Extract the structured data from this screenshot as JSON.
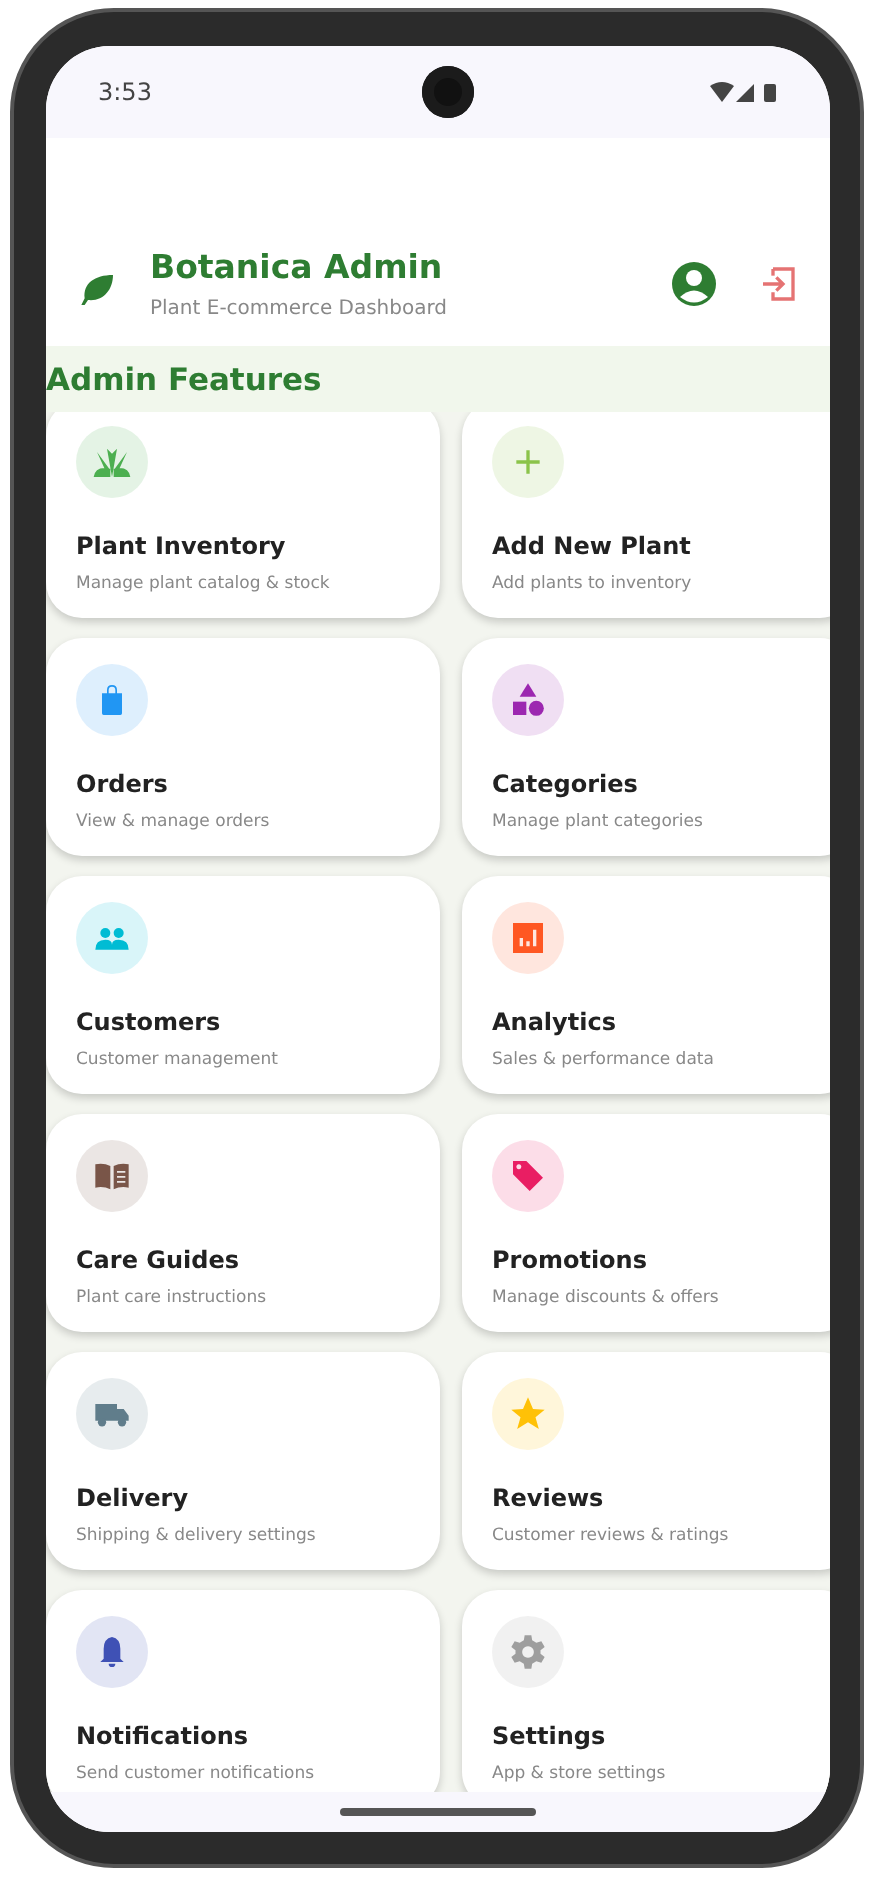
{
  "status_bar": {
    "time": "3:53"
  },
  "header": {
    "title": "Botanica Admin",
    "subtitle": "Plant E-commerce Dashboard"
  },
  "section": {
    "title": "Admin Features"
  },
  "features": [
    {
      "title": "Plant Inventory",
      "subtitle": "Manage plant catalog & stock",
      "color": "#4caf50"
    },
    {
      "title": "Add New Plant",
      "subtitle": "Add plants to inventory",
      "color": "#8bc34a"
    },
    {
      "title": "Orders",
      "subtitle": "View & manage orders",
      "color": "#2196f3"
    },
    {
      "title": "Categories",
      "subtitle": "Manage plant categories",
      "color": "#9c27b0"
    },
    {
      "title": "Customers",
      "subtitle": "Customer management",
      "color": "#00bcd4"
    },
    {
      "title": "Analytics",
      "subtitle": "Sales & performance data",
      "color": "#ff5722"
    },
    {
      "title": "Care Guides",
      "subtitle": "Plant care instructions",
      "color": "#795548"
    },
    {
      "title": "Promotions",
      "subtitle": "Manage discounts & offers",
      "color": "#e91e63"
    },
    {
      "title": "Delivery",
      "subtitle": "Shipping & delivery settings",
      "color": "#607d8b"
    },
    {
      "title": "Reviews",
      "subtitle": "Customer reviews & ratings",
      "color": "#ffc107"
    },
    {
      "title": "Notifications",
      "subtitle": "Send customer notifications",
      "color": "#3f51b5"
    },
    {
      "title": "Settings",
      "subtitle": "App & store settings",
      "color": "#9e9e9e"
    }
  ]
}
